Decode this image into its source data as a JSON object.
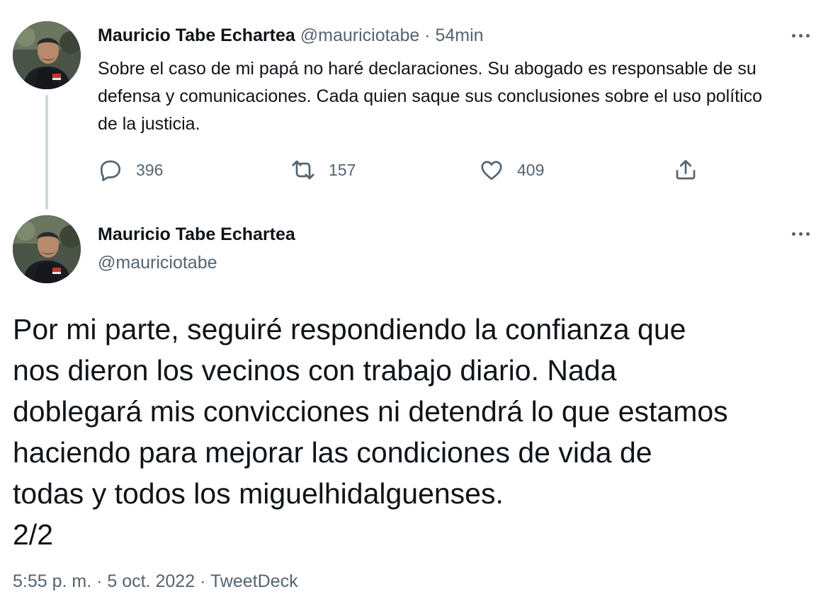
{
  "tweet1": {
    "name": "Mauricio Tabe Echartea",
    "handle": "@mauriciotabe",
    "separator": "·",
    "time": "54min",
    "text": "Sobre el caso de mi papá no haré declaraciones. Su abogado es responsable de su defensa y comunicaciones. Cada quien saque sus conclusiones sobre el uso político de la justicia.",
    "replies": "396",
    "retweets": "157",
    "likes": "409",
    "icons": {
      "more": "more-horizontal-icon",
      "reply": "reply-bubble-icon",
      "retweet": "retweet-icon",
      "like": "heart-icon",
      "share": "share-upload-icon"
    }
  },
  "tweet2": {
    "name": "Mauricio Tabe Echartea",
    "handle": "@mauriciotabe",
    "text_lines": [
      "Por mi parte, seguiré respondiendo la confianza que",
      "nos dieron los vecinos con trabajo diario. Nada",
      "doblegará mis convicciones ni detendrá lo que estamos",
      "haciendo para mejorar las condiciones de vida de",
      "todas y todos los miguelhidalguenses.",
      "2/2"
    ],
    "time": "5:55 p. m.",
    "separator": "·",
    "date": "5 oct. 2022",
    "separator2": "·",
    "source": "TweetDeck"
  },
  "colors": {
    "text_primary": "#0f1419",
    "text_secondary": "#536471",
    "thread_line": "#cfd9de"
  }
}
